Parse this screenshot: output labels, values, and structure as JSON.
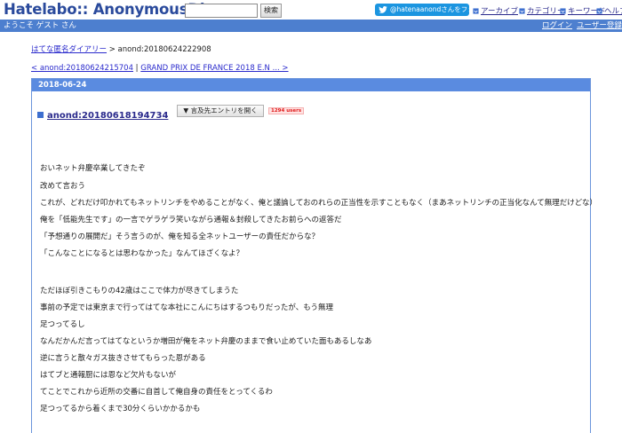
{
  "header": {
    "logo": "Hatelabo:: AnonymousDiary",
    "search": {
      "value": "",
      "placeholder": "",
      "button_label": "検索"
    },
    "follow_button": "@hatenaanondさんをフォロー",
    "nav": [
      {
        "label": "アーカイブ",
        "icon": "archive-icon"
      },
      {
        "label": "カテゴリー",
        "icon": "category-icon"
      },
      {
        "label": "キーワード",
        "icon": "keyword-icon"
      },
      {
        "label": "ヘルプ",
        "icon": "help-icon"
      }
    ]
  },
  "user_bar": {
    "welcome": "ようこそ ゲスト さん",
    "login": "ログイン",
    "register": "ユーザー登録"
  },
  "breadcrumb": {
    "home": "はてな匿名ダイアリー",
    "separator": " > ",
    "current": "anond:20180624222908"
  },
  "pager": {
    "prev": "< anond:20180624215704",
    "separator": " | ",
    "next": "GRAND PRIX DE FRANCE 2018 E.N ... >"
  },
  "entry": {
    "date": "2018-06-24",
    "title": "anond:20180618194734",
    "ref_button": "▼ 言及先エントリを開く",
    "users_badge": "1294 users",
    "lines": [
      "おいネット弁慶卒業してきたぞ",
      "改めて言おう",
      "これが、どれだけ叩かれてもネットリンチをやめることがなく、俺と議論しておのれらの正当性を示すこともなく（まあネットリンチの正当化なんて無理だけどな）",
      "俺を「低能先生です」の一言でゲラゲラ笑いながら通報＆封殺してきたお前らへの返答だ",
      "「予想通りの展開だ」そう言うのが、俺を知る全ネットユーザーの責任だからな？",
      "「こんなことになるとは思わなかった」なんてほざくなよ？",
      "",
      "ただほぼ引きこもりの42歳はここで体力が尽きてしまうた",
      "事前の予定では東京まで行ってはてな本社にこんにちはするつもりだったが、もう無理",
      "足つってるし",
      "なんだかんだ言ってはてなというか増田が俺をネット弁慶のままで食い止めていた面もあるしなあ",
      "逆に言うと散々ガス抜きさせてもらった恩がある",
      "はてブと通報厨には恩など欠片もないが",
      "てことでこれから近所の交番に自首して俺自身の責任をとってくるわ",
      "足つってるから着くまで30分くらいかかるかも"
    ]
  },
  "colors": {
    "logo": "#2a4a9c",
    "user_bar": "#4d7fcf",
    "date_bar": "#5a8be0",
    "link": "#2a2acc",
    "twitter": "#1b95e0",
    "users_badge": "#e01b1b"
  }
}
